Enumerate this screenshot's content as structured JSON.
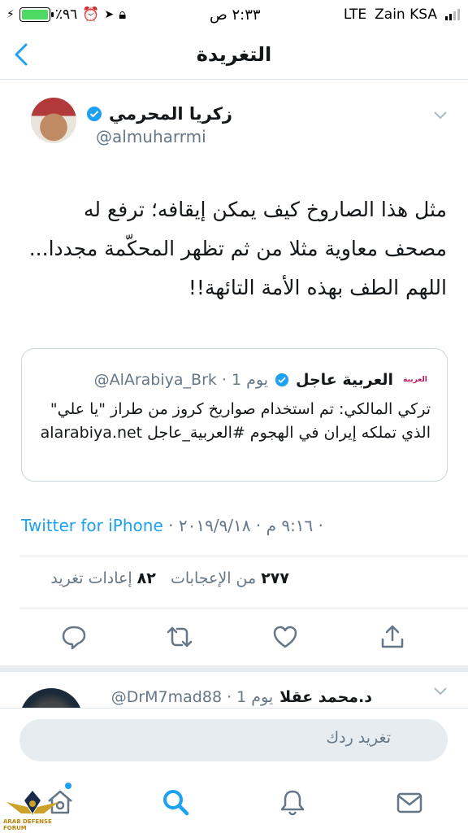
{
  "status_bar": {
    "battery_pct": "٪٩٦",
    "time": "٢:٣٣ ص",
    "network": "LTE",
    "carrier": "Zain KSA"
  },
  "nav": {
    "title": "التغريدة"
  },
  "tweet": {
    "author_name": "زكريا المحرمي",
    "author_handle": "@almuharrmi",
    "text": "مثل هذا الصاروخ كيف يمكن إيقافه؛ ترفع له مصحف معاوية مثلا من ثم تظهر المحكّمة مجددا... اللهم الطف بهذه الأمة التائهة!!",
    "quote": {
      "name": "العربية عاجل",
      "meta": "@AlArabiya_Brk · 1 يوم",
      "logo_text": "العربية",
      "text": "تركي المالكي: تم استخدام صواريخ كروز من طراز \"يا علي\" الذي تملكه إيران في الهجوم #العربية_عاجل alarabiya.net"
    },
    "client": "Twitter for iPhone",
    "timestamp": "٩:١٦ م · ٢٠١٩/٩/١٨ ·",
    "likes_count": "٢٧٧",
    "likes_label": "من الإعجابات",
    "retweets_count": "٨٢",
    "retweets_label": "إعادات تغريد"
  },
  "reply": {
    "name": "د.محمد عقلا",
    "meta": "@DrM7mad88 · 1 يوم"
  },
  "compose": {
    "placeholder": "تغريد ردك"
  },
  "watermark": {
    "text": "ARAB DEFENSE FORUM"
  },
  "colors": {
    "accent": "#1da1f2",
    "muted": "#657786",
    "verified": "#1da1f2"
  },
  "icons": [
    "back-chevron-icon",
    "chevron-down-icon",
    "verified-icon",
    "reply-icon",
    "retweet-icon",
    "like-icon",
    "share-icon",
    "home-icon",
    "search-icon",
    "notifications-icon",
    "messages-icon"
  ]
}
